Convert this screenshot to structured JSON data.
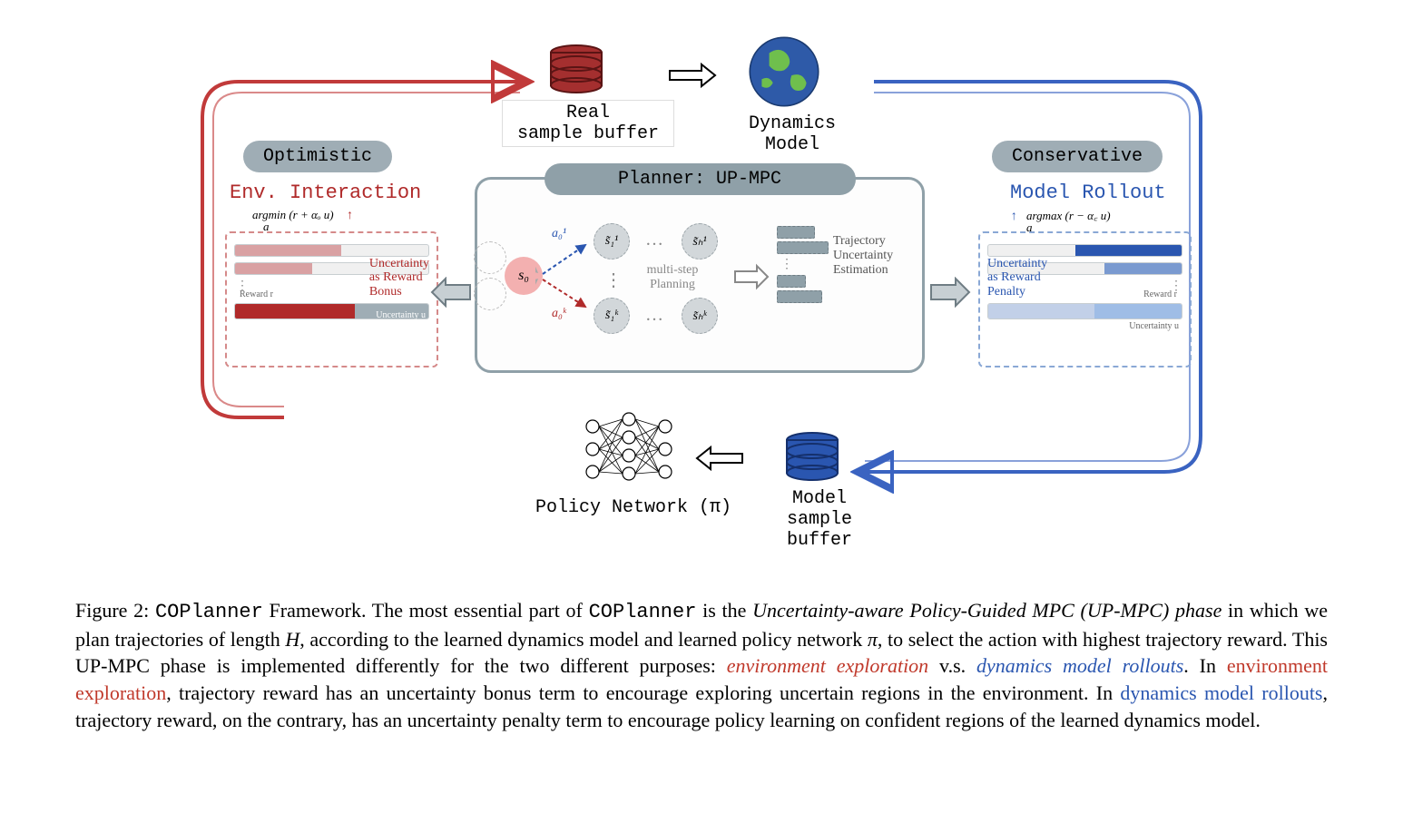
{
  "top": {
    "real_buffer": "Real\nsample buffer",
    "dyn_model": "Dynamics Model"
  },
  "left": {
    "tag": "Optimistic",
    "title": "Env. Interaction",
    "argline": "argmin (r + αₒ u)",
    "sub_a": "a",
    "unc": "Uncertainty\nas Reward\nBonus",
    "reward_lbl": "Reward r",
    "unc_lbl": "Uncertainty u"
  },
  "right": {
    "tag": "Conservative",
    "title": "Model Rollout",
    "argline": "argmax (r − α꜀ u)",
    "sub_a": "a",
    "unc": "Uncertainty\nas Reward\nPenalty",
    "reward_lbl": "Reward r",
    "unc_lbl": "Uncertainty u"
  },
  "planner": {
    "header": "Planner: UP-MPC",
    "s0": "s₀",
    "a01": "a₀¹",
    "a0k": "a₀ᵏ",
    "s11": "s̃₁¹",
    "s1k": "s̃₁ᵏ",
    "sH1": "s̃ₕ¹",
    "sHk": "s̃ₕᵏ",
    "multi": "multi-step\nPlanning",
    "traj": "Trajectory\nUncertainty\nEstimation"
  },
  "bottom": {
    "policy": "Policy Network (π)",
    "model_buffer": "Model\nsample buffer"
  },
  "caption": {
    "fignum": "Figure 2:",
    "name": "COPlanner",
    "t1": " Framework. The most essential part of ",
    "t2": " is the ",
    "phase": "Uncertainty-aware Policy-Guided MPC (UP-MPC) phase",
    "t3": " in which we plan trajectories of length ",
    "H": "H",
    "t4": ", according to the learned dynamics model and learned policy network ",
    "pi": "π",
    "t5": ", to select the action with highest trajectory reward. This UP-MPC phase is implemented differently for the two different purposes: ",
    "env_expl_i": "environment exploration",
    "vs": " v.s. ",
    "dyn_roll_i": "dynamics model rollouts",
    "t6": ". In ",
    "env_expl2": "environment exploration",
    "t7": ", trajectory reward has an uncertainty bonus term to encourage exploring uncertain regions in the environment. In ",
    "dyn_roll2": "dynamics model rollouts",
    "t8": ", trajectory reward, on the contrary, has an uncertainty penalty term to encourage policy learning on confident regions of the learned dynamics model."
  }
}
